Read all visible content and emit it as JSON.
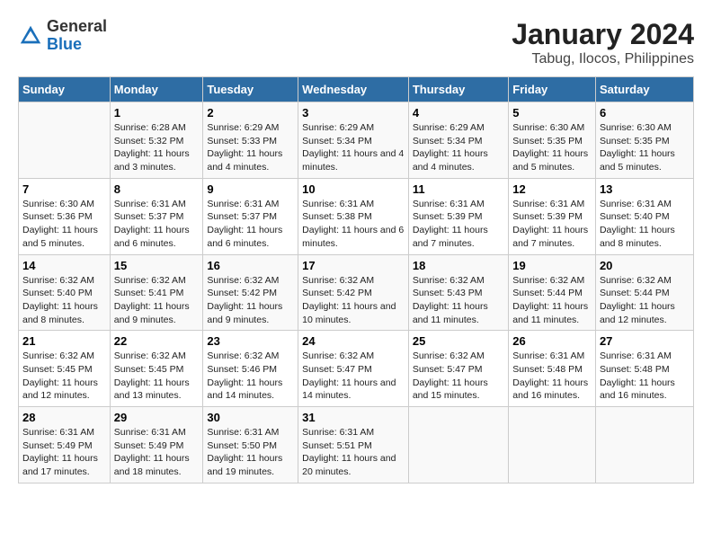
{
  "header": {
    "logo_general": "General",
    "logo_blue": "Blue",
    "title": "January 2024",
    "subtitle": "Tabug, Ilocos, Philippines"
  },
  "columns": [
    "Sunday",
    "Monday",
    "Tuesday",
    "Wednesday",
    "Thursday",
    "Friday",
    "Saturday"
  ],
  "weeks": [
    [
      {
        "day": "",
        "info": ""
      },
      {
        "day": "1",
        "info": "Sunrise: 6:28 AM\nSunset: 5:32 PM\nDaylight: 11 hours\nand 3 minutes."
      },
      {
        "day": "2",
        "info": "Sunrise: 6:29 AM\nSunset: 5:33 PM\nDaylight: 11 hours\nand 4 minutes."
      },
      {
        "day": "3",
        "info": "Sunrise: 6:29 AM\nSunset: 5:34 PM\nDaylight: 11 hours\nand 4 minutes."
      },
      {
        "day": "4",
        "info": "Sunrise: 6:29 AM\nSunset: 5:34 PM\nDaylight: 11 hours\nand 4 minutes."
      },
      {
        "day": "5",
        "info": "Sunrise: 6:30 AM\nSunset: 5:35 PM\nDaylight: 11 hours\nand 5 minutes."
      },
      {
        "day": "6",
        "info": "Sunrise: 6:30 AM\nSunset: 5:35 PM\nDaylight: 11 hours\nand 5 minutes."
      }
    ],
    [
      {
        "day": "7",
        "info": "Sunrise: 6:30 AM\nSunset: 5:36 PM\nDaylight: 11 hours\nand 5 minutes."
      },
      {
        "day": "8",
        "info": "Sunrise: 6:31 AM\nSunset: 5:37 PM\nDaylight: 11 hours\nand 6 minutes."
      },
      {
        "day": "9",
        "info": "Sunrise: 6:31 AM\nSunset: 5:37 PM\nDaylight: 11 hours\nand 6 minutes."
      },
      {
        "day": "10",
        "info": "Sunrise: 6:31 AM\nSunset: 5:38 PM\nDaylight: 11 hours\nand 6 minutes."
      },
      {
        "day": "11",
        "info": "Sunrise: 6:31 AM\nSunset: 5:39 PM\nDaylight: 11 hours\nand 7 minutes."
      },
      {
        "day": "12",
        "info": "Sunrise: 6:31 AM\nSunset: 5:39 PM\nDaylight: 11 hours\nand 7 minutes."
      },
      {
        "day": "13",
        "info": "Sunrise: 6:31 AM\nSunset: 5:40 PM\nDaylight: 11 hours\nand 8 minutes."
      }
    ],
    [
      {
        "day": "14",
        "info": "Sunrise: 6:32 AM\nSunset: 5:40 PM\nDaylight: 11 hours\nand 8 minutes."
      },
      {
        "day": "15",
        "info": "Sunrise: 6:32 AM\nSunset: 5:41 PM\nDaylight: 11 hours\nand 9 minutes."
      },
      {
        "day": "16",
        "info": "Sunrise: 6:32 AM\nSunset: 5:42 PM\nDaylight: 11 hours\nand 9 minutes."
      },
      {
        "day": "17",
        "info": "Sunrise: 6:32 AM\nSunset: 5:42 PM\nDaylight: 11 hours\nand 10 minutes."
      },
      {
        "day": "18",
        "info": "Sunrise: 6:32 AM\nSunset: 5:43 PM\nDaylight: 11 hours\nand 11 minutes."
      },
      {
        "day": "19",
        "info": "Sunrise: 6:32 AM\nSunset: 5:44 PM\nDaylight: 11 hours\nand 11 minutes."
      },
      {
        "day": "20",
        "info": "Sunrise: 6:32 AM\nSunset: 5:44 PM\nDaylight: 11 hours\nand 12 minutes."
      }
    ],
    [
      {
        "day": "21",
        "info": "Sunrise: 6:32 AM\nSunset: 5:45 PM\nDaylight: 11 hours\nand 12 minutes."
      },
      {
        "day": "22",
        "info": "Sunrise: 6:32 AM\nSunset: 5:45 PM\nDaylight: 11 hours\nand 13 minutes."
      },
      {
        "day": "23",
        "info": "Sunrise: 6:32 AM\nSunset: 5:46 PM\nDaylight: 11 hours\nand 14 minutes."
      },
      {
        "day": "24",
        "info": "Sunrise: 6:32 AM\nSunset: 5:47 PM\nDaylight: 11 hours\nand 14 minutes."
      },
      {
        "day": "25",
        "info": "Sunrise: 6:32 AM\nSunset: 5:47 PM\nDaylight: 11 hours\nand 15 minutes."
      },
      {
        "day": "26",
        "info": "Sunrise: 6:31 AM\nSunset: 5:48 PM\nDaylight: 11 hours\nand 16 minutes."
      },
      {
        "day": "27",
        "info": "Sunrise: 6:31 AM\nSunset: 5:48 PM\nDaylight: 11 hours\nand 16 minutes."
      }
    ],
    [
      {
        "day": "28",
        "info": "Sunrise: 6:31 AM\nSunset: 5:49 PM\nDaylight: 11 hours\nand 17 minutes."
      },
      {
        "day": "29",
        "info": "Sunrise: 6:31 AM\nSunset: 5:49 PM\nDaylight: 11 hours\nand 18 minutes."
      },
      {
        "day": "30",
        "info": "Sunrise: 6:31 AM\nSunset: 5:50 PM\nDaylight: 11 hours\nand 19 minutes."
      },
      {
        "day": "31",
        "info": "Sunrise: 6:31 AM\nSunset: 5:51 PM\nDaylight: 11 hours\nand 20 minutes."
      },
      {
        "day": "",
        "info": ""
      },
      {
        "day": "",
        "info": ""
      },
      {
        "day": "",
        "info": ""
      }
    ]
  ]
}
